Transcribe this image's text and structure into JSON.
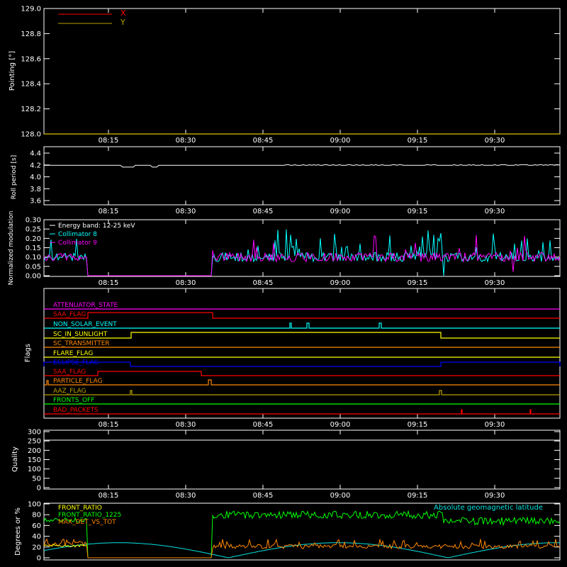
{
  "colors": {
    "axis": "#ffffff",
    "x_series": "#ff0000",
    "y_series": "#b8a000",
    "roll": "#ffffff",
    "energy": "#ffffff",
    "collimator8": "#00ffff",
    "collimator9": "#ff00ff",
    "front_ratio": "#ffff00",
    "front_ratio_1225": "#00ff00",
    "max_det": "#ff8800",
    "geomag": "#00e0e0"
  },
  "time_ticks": [
    "08:15",
    "08:30",
    "08:45",
    "09:00",
    "09:15",
    "09:30"
  ],
  "chart_data": [
    {
      "type": "line",
      "ylabel": "Pointing [°]",
      "yticks": [
        "128.0",
        "128.2",
        "128.4",
        "128.6",
        "128.8",
        "129.0"
      ],
      "ylim": [
        128.0,
        129.0
      ],
      "legend": [
        "X",
        "Y"
      ],
      "series": [
        {
          "name": "X",
          "values": [
            128.0,
            128.0
          ]
        },
        {
          "name": "Y",
          "values": [
            128.0,
            128.0
          ]
        }
      ]
    },
    {
      "type": "line",
      "ylabel": "Roll period [s]",
      "yticks": [
        "3.6",
        "3.8",
        "4.0",
        "4.2",
        "4.4"
      ],
      "ylim": [
        3.5,
        4.5
      ],
      "series": [
        {
          "values": [
            4.18,
            4.18,
            4.16,
            4.18,
            4.17,
            4.18,
            4.18,
            4.18,
            4.18,
            4.17
          ]
        }
      ]
    },
    {
      "type": "line",
      "ylabel": "Normalized modulation",
      "yticks": [
        "0.00",
        "0.05",
        "0.10",
        "0.15",
        "0.20",
        "0.25",
        "0.30"
      ],
      "ylim": [
        0,
        0.3
      ],
      "legend": [
        "Energy band: 12-25 keV",
        "Collimator 8",
        "Collimator 9"
      ],
      "series": [
        {
          "name": "Collimator 8",
          "values": [
            0.1,
            0.1,
            0.0,
            0.0,
            0.0,
            0.1,
            0.11,
            0.1,
            0.1,
            0.1
          ]
        },
        {
          "name": "Collimator 9",
          "values": [
            0.1,
            0.1,
            0.0,
            0.0,
            0.0,
            0.1,
            0.1,
            0.1,
            0.1,
            0.1
          ]
        }
      ]
    },
    {
      "type": "table",
      "ylabel": "Flags",
      "flags": [
        {
          "name": "ATTENUATOR_STATE",
          "color": "#ff00ff"
        },
        {
          "name": "SAA_FLAG",
          "color": "#ff0000"
        },
        {
          "name": "NON_SOLAR_EVENT",
          "color": "#00ffff"
        },
        {
          "name": "SC_IN_SUNLIGHT",
          "color": "#ffff00"
        },
        {
          "name": "SC_TRANSMITTER",
          "color": "#ff8800"
        },
        {
          "name": "FLARE_FLAG",
          "color": "#ffff00"
        },
        {
          "name": "ECLIPSE_FLAG",
          "color": "#0000ff"
        },
        {
          "name": "SAA_FLAG",
          "color": "#ff0000"
        },
        {
          "name": "PARTICLE_FLAG",
          "color": "#ff8800"
        },
        {
          "name": "AAZ_FLAG",
          "color": "#b8a000"
        },
        {
          "name": "FRONTS_OFF",
          "color": "#00ff00"
        },
        {
          "name": "BAD_PACKETS",
          "color": "#ff0000"
        }
      ]
    },
    {
      "type": "line",
      "ylabel": "Quality",
      "yticks": [
        "0",
        "50",
        "100",
        "150",
        "200",
        "250",
        "300"
      ],
      "ylim": [
        0,
        300
      ],
      "series": []
    },
    {
      "type": "line",
      "ylabel": "Degrees or %",
      "yticks": [
        "0",
        "20",
        "40",
        "60",
        "80",
        "100"
      ],
      "ylim": [
        0,
        100
      ],
      "legend": [
        "FRONT_RATIO",
        "FRONT_RATIO_1225",
        "MAX_DET_VS_TOT",
        "Absolute geomagnetic latitude"
      ],
      "series": [
        {
          "name": "FRONT_RATIO_1225",
          "values": [
            70,
            70,
            0,
            0,
            0,
            80,
            82,
            80,
            75,
            70
          ]
        },
        {
          "name": "MAX_DET_VS_TOT",
          "values": [
            20,
            25,
            0,
            0,
            0,
            18,
            17,
            17,
            18,
            20
          ]
        },
        {
          "name": "Absolute geomagnetic latitude",
          "values": [
            25,
            28,
            25,
            15,
            2,
            20,
            28,
            25,
            10,
            18
          ]
        }
      ]
    }
  ]
}
